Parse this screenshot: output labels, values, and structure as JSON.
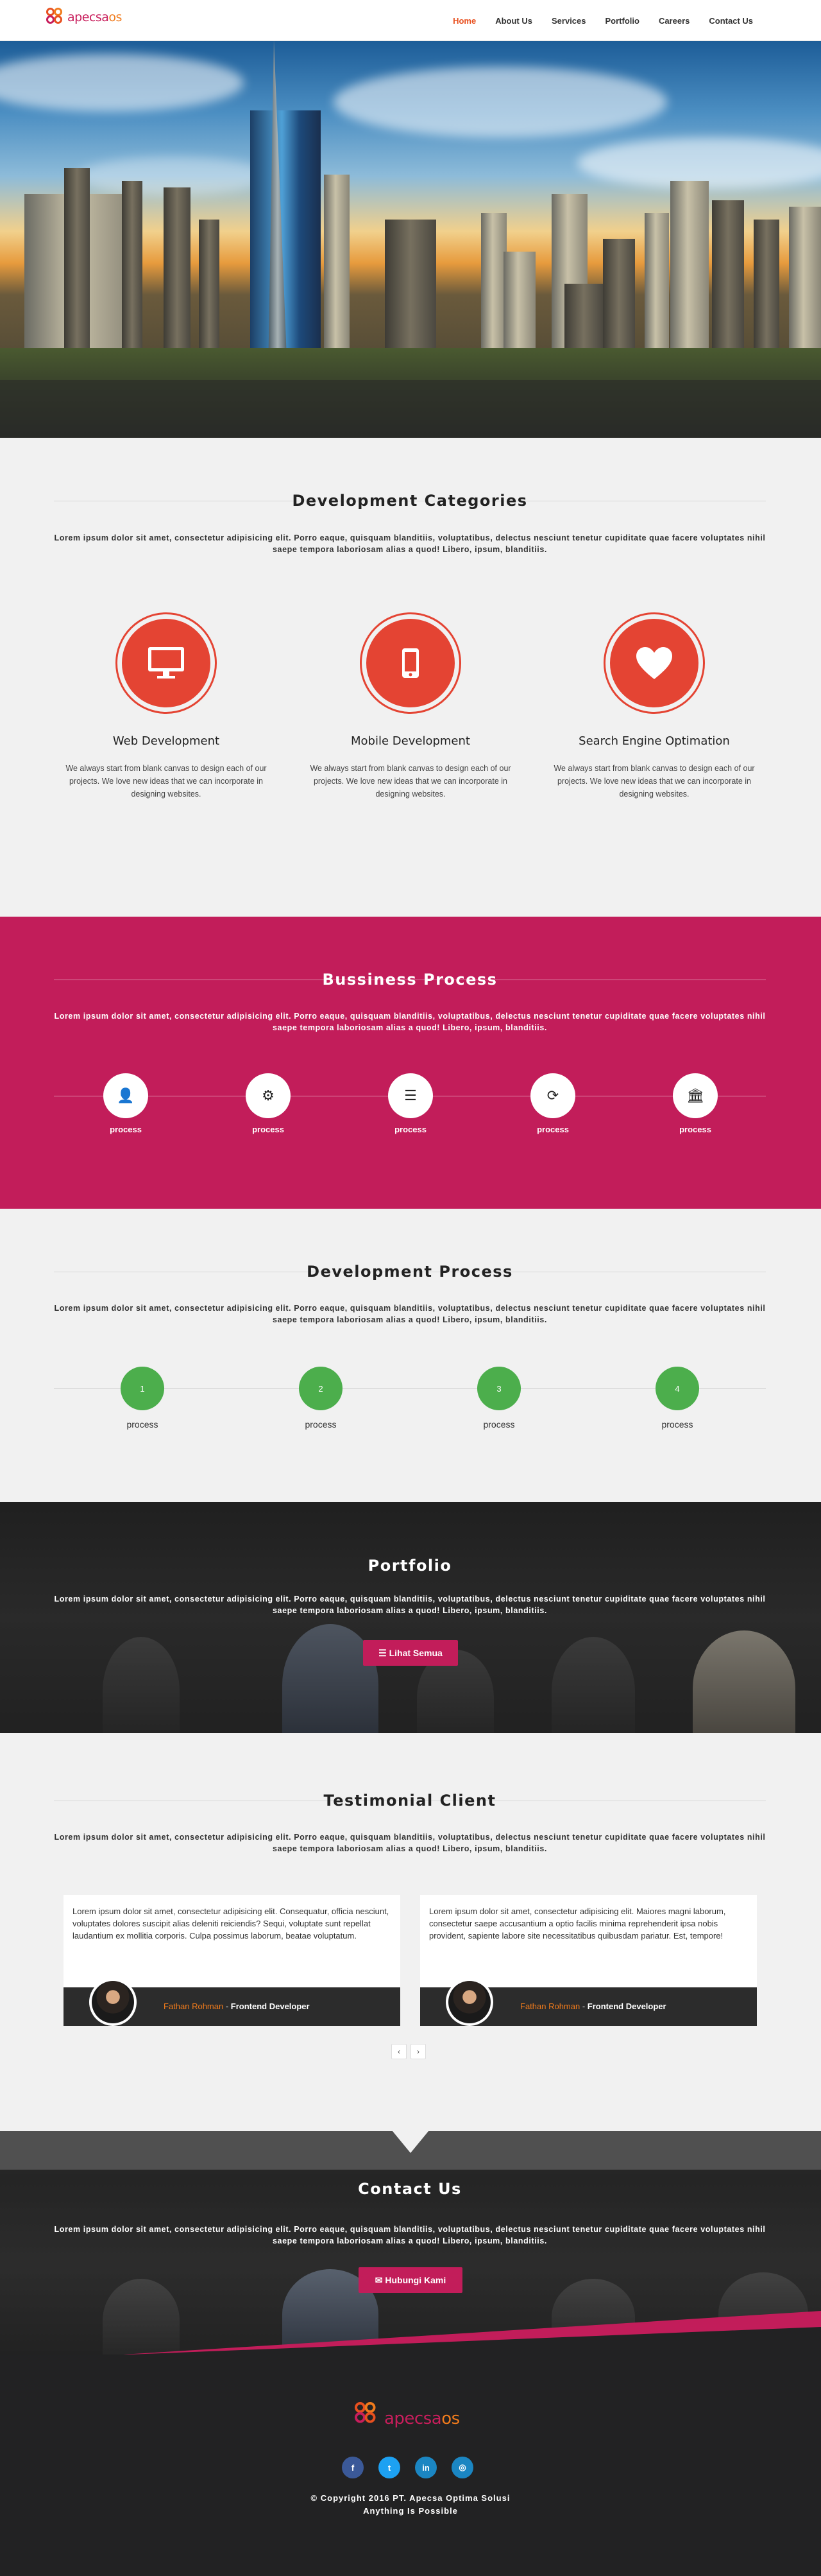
{
  "brand": {
    "logo_part1": "apecsa",
    "logo_part2": "os"
  },
  "nav": {
    "items": [
      {
        "label": "Home"
      },
      {
        "label": "About Us"
      },
      {
        "label": "Services"
      },
      {
        "label": "Portfolio"
      },
      {
        "label": "Careers"
      },
      {
        "label": "Contact Us"
      }
    ]
  },
  "lorem": "Lorem ipsum dolor sit amet, consectetur adipisicing elit. Porro eaque, quisquam blanditiis, voluptatibus, delectus nesciunt tenetur cupiditate quae facere voluptates nihil saepe tempora laboriosam alias a quod! Libero, ipsum, blanditiis.",
  "categories": {
    "title": "Development Categories",
    "items": [
      {
        "title": "Web Development",
        "icon": "monitor-icon",
        "text": "We always start from blank canvas to design each of our projects. We love new ideas that we can incorporate in designing websites."
      },
      {
        "title": "Mobile Development",
        "icon": "mobile-icon",
        "text": "We always start from blank canvas to design each of our projects. We love new ideas that we can incorporate in designing websites."
      },
      {
        "title": "Search Engine Optimation",
        "icon": "heart-icon",
        "text": "We always start from blank canvas to design each of our projects. We love new ideas that we can incorporate in designing websites."
      }
    ]
  },
  "business": {
    "title": "Bussiness Process",
    "steps": [
      {
        "label": "process",
        "icon": "user-icon",
        "glyph": "👤"
      },
      {
        "label": "process",
        "icon": "gear-icon",
        "glyph": "⚙"
      },
      {
        "label": "process",
        "icon": "list-icon",
        "glyph": "☰"
      },
      {
        "label": "process",
        "icon": "refresh-icon",
        "glyph": "⟳"
      },
      {
        "label": "process",
        "icon": "bank-icon",
        "glyph": "🏛"
      }
    ]
  },
  "development": {
    "title": "Development Process",
    "steps": [
      {
        "num": "1",
        "label": "process"
      },
      {
        "num": "2",
        "label": "process"
      },
      {
        "num": "3",
        "label": "process"
      },
      {
        "num": "4",
        "label": "process"
      }
    ]
  },
  "portfolio": {
    "title": "Portfolio",
    "button": "☰ Lihat Semua"
  },
  "testimonial": {
    "title": "Testimonial Client",
    "items": [
      {
        "text": "Lorem ipsum dolor sit amet, consectetur adipisicing elit. Consequatur, officia nesciunt, voluptates dolores suscipit alias deleniti reiciendis? Sequi, voluptate sunt repellat laudantium ex mollitia corporis. Culpa possimus laborum, beatae voluptatum.",
        "name": "Fathan Rohman",
        "sep": " - ",
        "role": "Frontend Developer"
      },
      {
        "text": "Lorem ipsum dolor sit amet, consectetur adipisicing elit. Maiores magni laborum, consectetur saepe accusantium a optio facilis minima reprehenderit ipsa nobis provident, sapiente labore site necessitatibus quibusdam pariatur. Est, tempore!",
        "name": "Fathan Rohman",
        "sep": " - ",
        "role": "Frontend Developer"
      }
    ],
    "prev": "‹",
    "next": "›"
  },
  "contact": {
    "title": "Contact Us",
    "button": "✉ Hubungi Kami"
  },
  "footer": {
    "social": [
      {
        "glyph": "f",
        "icon": "facebook-icon",
        "color": "#3b5998"
      },
      {
        "glyph": "t",
        "icon": "twitter-icon",
        "color": "#1da1f2"
      },
      {
        "glyph": "in",
        "icon": "linkedin-icon",
        "color": "#1b86c2"
      },
      {
        "glyph": "◎",
        "icon": "instagram-icon",
        "color": "#1b86c2"
      }
    ],
    "copyright": "© Copyright 2016 PT. Apecsa Optima Solusi",
    "tagline": "Anything Is Possible"
  },
  "colors": {
    "accent": "#e8501f",
    "pink": "#c21d5a",
    "red": "#e44433",
    "green": "#4cae4c",
    "dark": "#222223"
  }
}
